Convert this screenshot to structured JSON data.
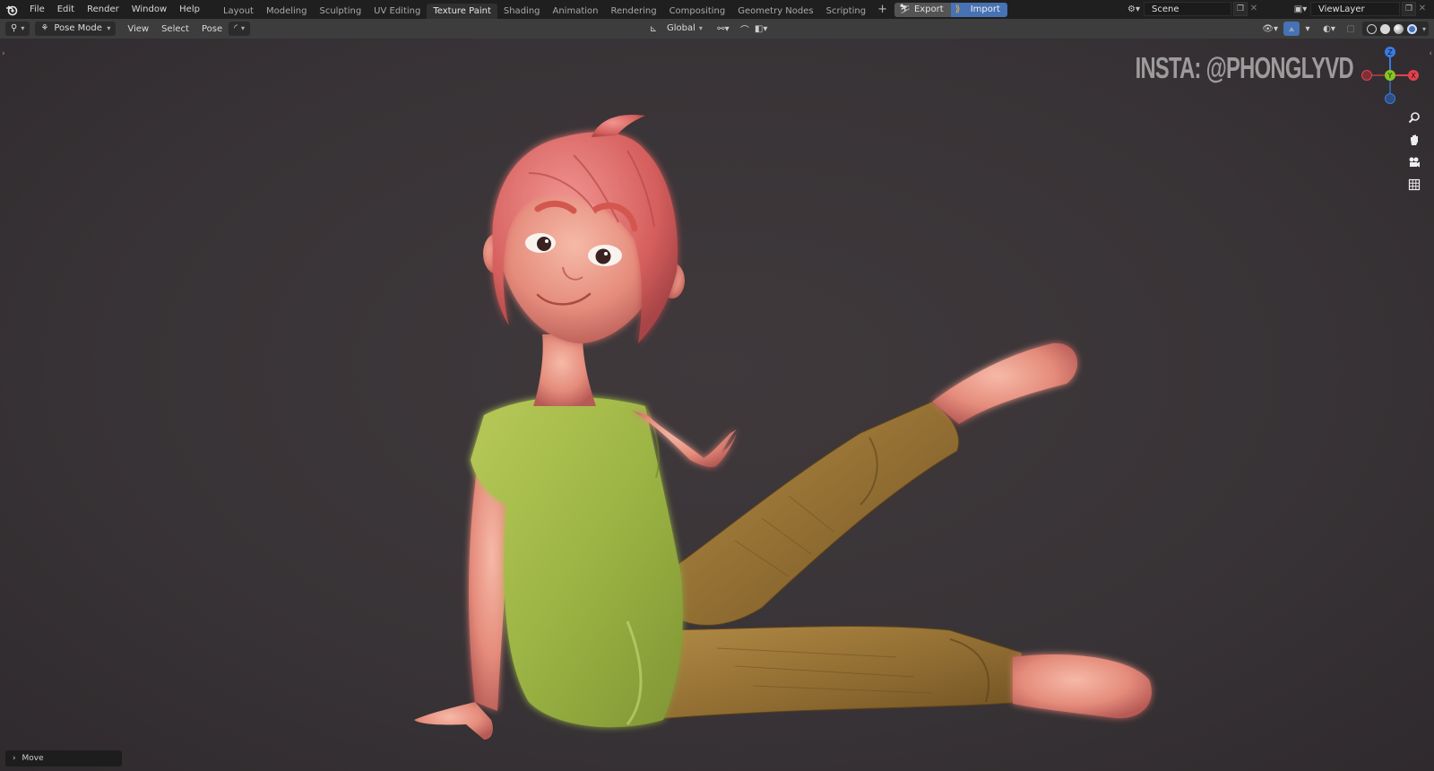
{
  "topbar": {
    "menus": [
      "File",
      "Edit",
      "Render",
      "Window",
      "Help"
    ],
    "workspaces": [
      "Layout",
      "Modeling",
      "Sculpting",
      "UV Editing",
      "Texture Paint",
      "Shading",
      "Animation",
      "Rendering",
      "Compositing",
      "Geometry Nodes",
      "Scripting"
    ],
    "active_workspace": "Texture Paint",
    "add_label": "+",
    "export_label": "Export",
    "import_label": "Import",
    "scene": "Scene",
    "view_layer": "ViewLayer"
  },
  "header": {
    "mode": "Pose Mode",
    "menus": [
      "View",
      "Select",
      "Pose"
    ],
    "orientation": "Global"
  },
  "viewport": {
    "watermark": "INSTA: @PHONGLYVD",
    "gizmo": {
      "z": "Z",
      "y": "Y",
      "x": "X"
    },
    "last_operator": "Move"
  },
  "colors": {
    "accent": "#4772b3",
    "axis_x": "#e0434f",
    "axis_y": "#86c424",
    "axis_z": "#3a7be0"
  }
}
